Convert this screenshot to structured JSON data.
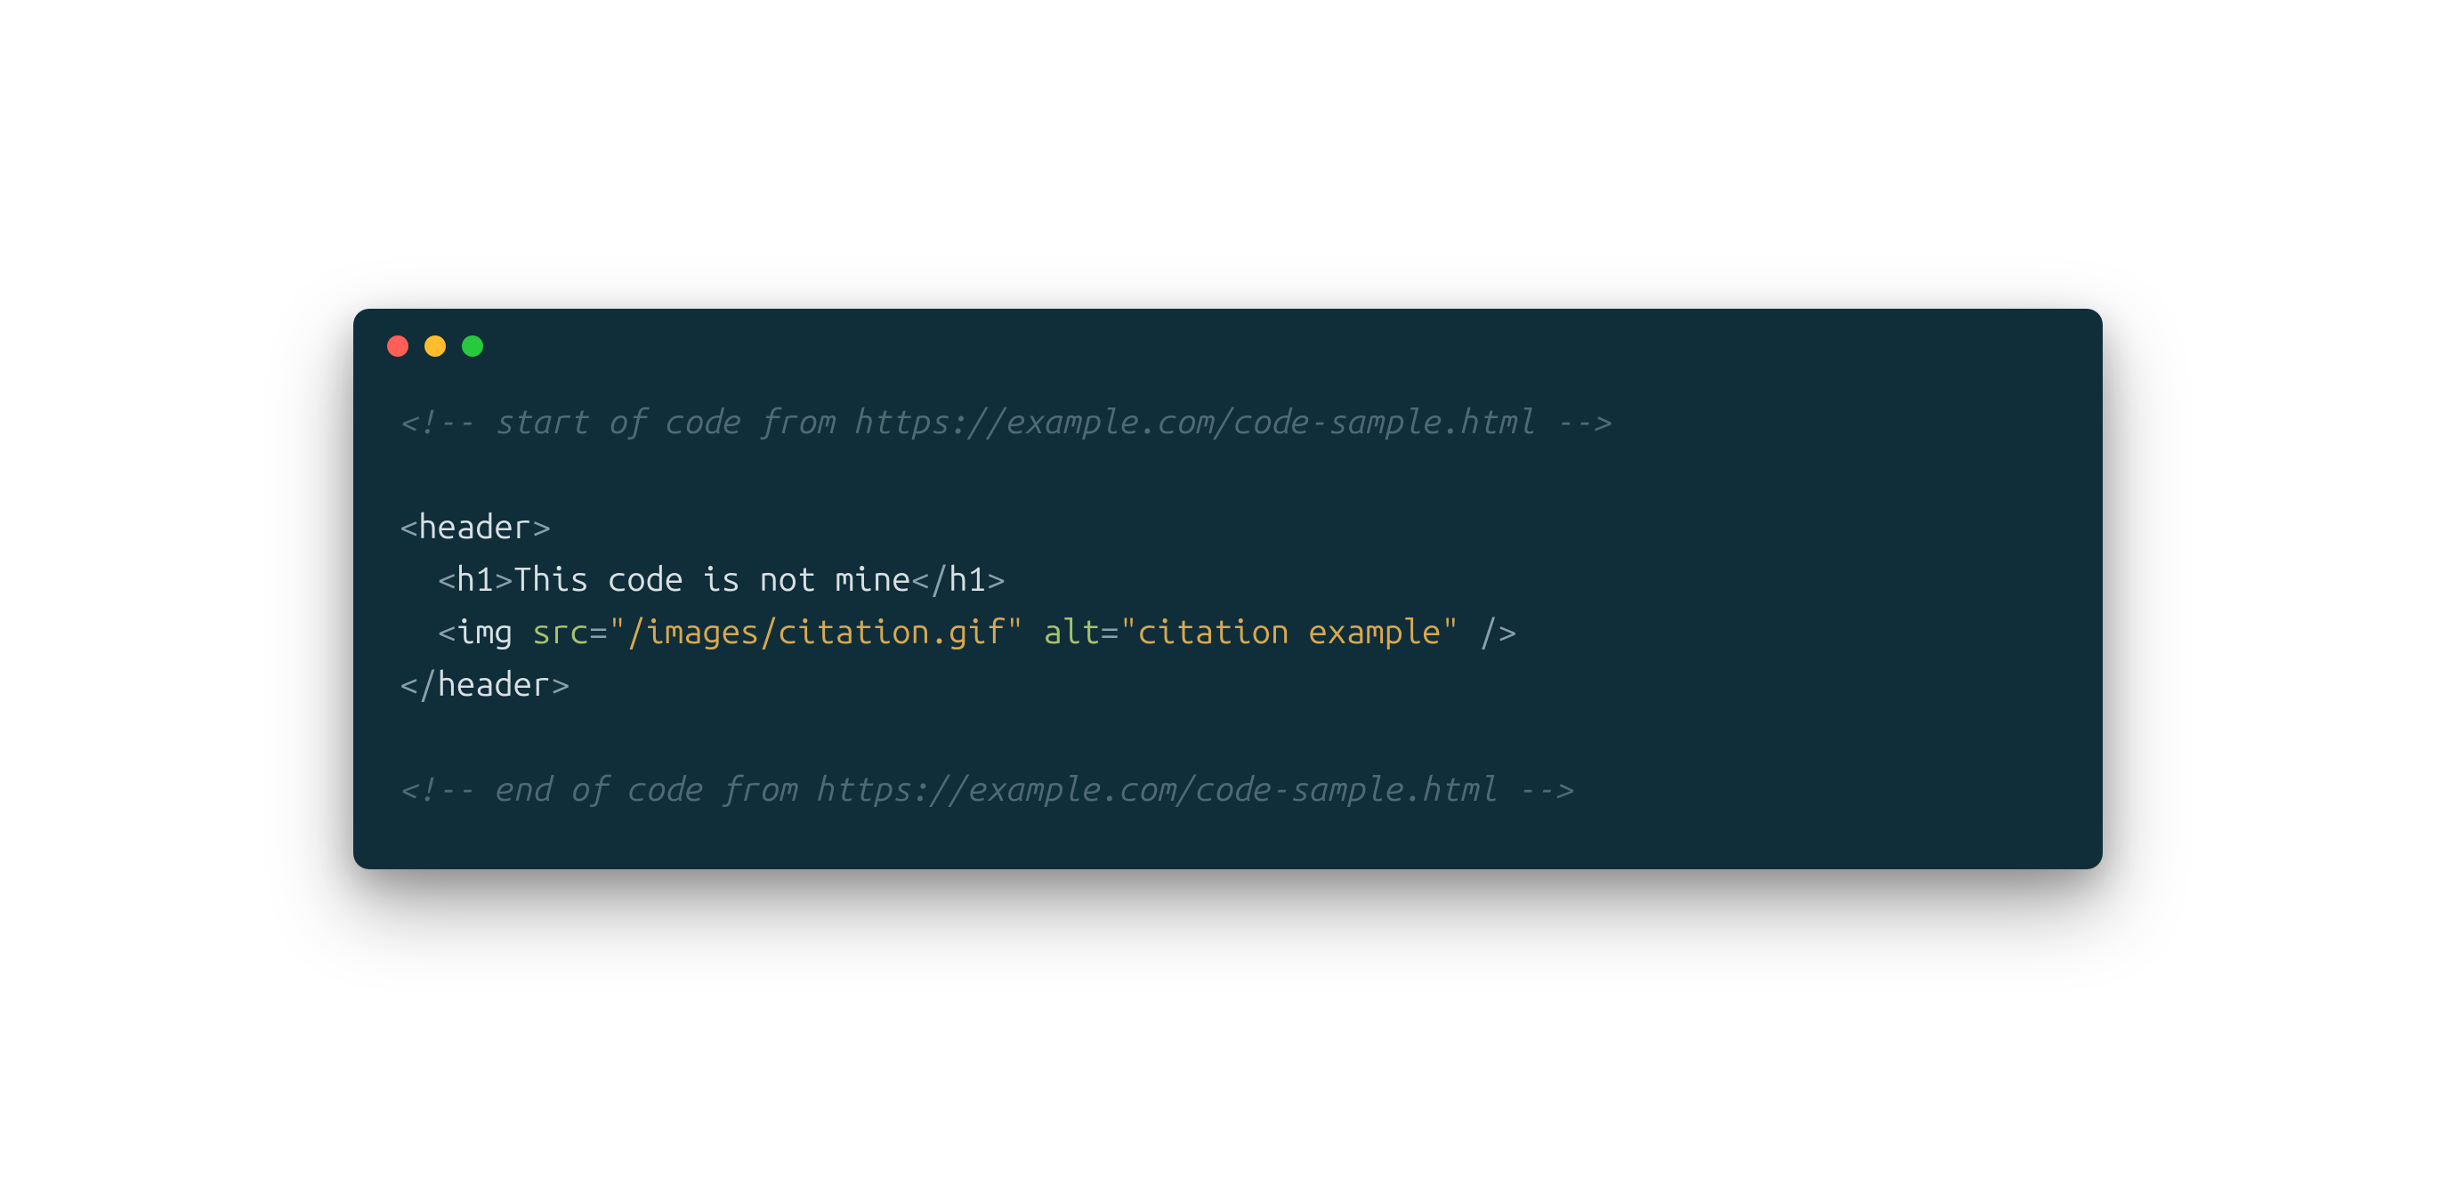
{
  "colors": {
    "window_bg": "#0f2e3a",
    "traffic_red": "#ff5f56",
    "traffic_yellow": "#ffbd2e",
    "traffic_green": "#27c93f",
    "comment": "#506a73",
    "punct": "#8aa0a8",
    "tag": "#d9e0e3",
    "attr": "#a7c26a",
    "string": "#d9a84f"
  },
  "code": {
    "comment_start": "<!-- start of code from https://example.com/code-sample.html -->",
    "header_open": {
      "lt": "<",
      "name": "header",
      "gt": ">"
    },
    "h1": {
      "open_lt": "<",
      "open_name": "h1",
      "open_gt": ">",
      "text": "This code is not mine",
      "close_lt": "</",
      "close_name": "h1",
      "close_gt": ">"
    },
    "img": {
      "lt": "<",
      "name": "img",
      "attr1": "src",
      "eq1": "=",
      "val1": "\"/images/citation.gif\"",
      "attr2": "alt",
      "eq2": "=",
      "val2": "\"citation example\"",
      "selfclose": "/>"
    },
    "header_close": {
      "lt": "</",
      "name": "header",
      "gt": ">"
    },
    "comment_end": "<!-- end of code from https://example.com/code-sample.html -->",
    "indent2": "  "
  }
}
